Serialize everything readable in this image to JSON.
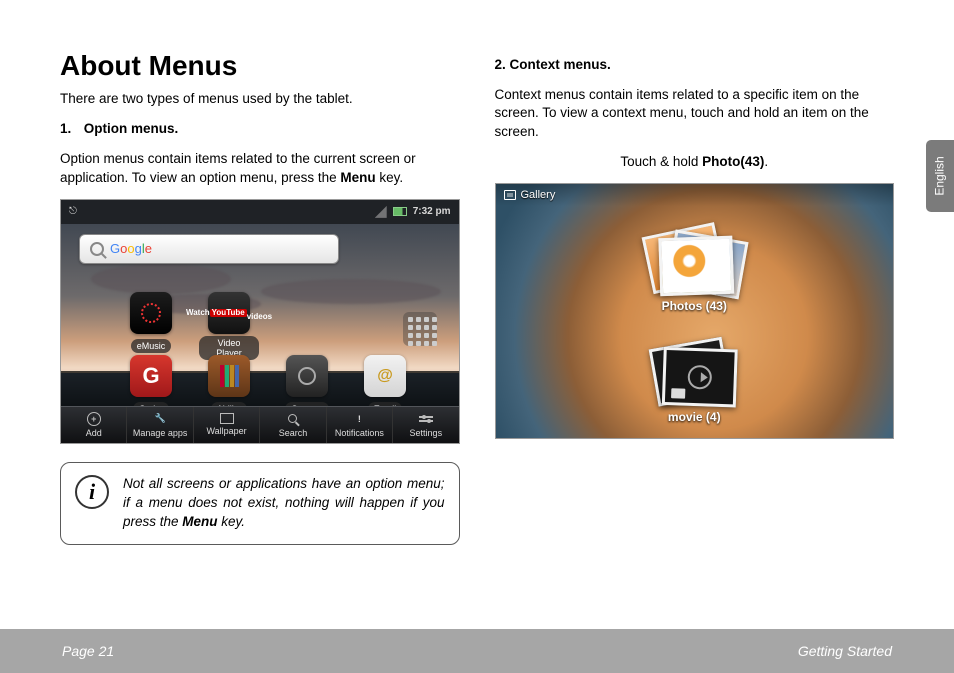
{
  "doc": {
    "title": "About Menus",
    "intro": "There are two types of menus used by the tablet.",
    "section1": {
      "num": "1.",
      "heading": "Option menus.",
      "body_pre": "Option menus contain items related to the current screen or application. To view an option menu, press the ",
      "body_bold": "Menu",
      "body_post": " key."
    },
    "section2": {
      "num": "2.",
      "heading": "Context menus.",
      "body": "Context menus contain items related to a specific item on the screen. To view a context menu, touch and hold an item on the screen.",
      "caption_pre": "Touch & hold ",
      "caption_bold": "Photo(43)",
      "caption_post": "."
    },
    "infobox": {
      "pre": "Not all screens or applications have an option menu; if a menu does not exist, nothing will happen if you press the ",
      "bold": "Menu",
      "post": " key."
    },
    "footer": {
      "left": "Page 21",
      "right": "Getting Started"
    },
    "sidetab": "English"
  },
  "home": {
    "time": "7:32 pm",
    "search_placeholder": "Google",
    "apps_row1": [
      {
        "label": "eMusic",
        "bg": "linear-gradient(#1d1d1d,#000)",
        "glyph": "◉"
      },
      {
        "label": "Video Player",
        "bg": "linear-gradient(#2b2b2b,#111)",
        "glyph": "You"
      }
    ],
    "apps_row2": [
      {
        "label": "Getjar",
        "bg": "linear-gradient(#d7372d,#a0181a)",
        "glyph": "G"
      },
      {
        "label": "Aldiko",
        "bg": "linear-gradient(#9c5a2a,#5e3517)",
        "glyph": "▥"
      },
      {
        "label": "Camera",
        "bg": "linear-gradient(#555,#222)",
        "glyph": "◎"
      },
      {
        "label": "Email",
        "bg": "linear-gradient(#e9d24f,#caa324)",
        "glyph": "@"
      }
    ],
    "menu": [
      {
        "label": "Add",
        "icon": "+"
      },
      {
        "label": "Manage apps",
        "icon": "🔧"
      },
      {
        "label": "Wallpaper",
        "icon": "🖼"
      },
      {
        "label": "Search",
        "icon": "🔍"
      },
      {
        "label": "Notifications",
        "icon": "!"
      },
      {
        "label": "Settings",
        "icon": "⚙"
      }
    ]
  },
  "gallery": {
    "header": "Gallery",
    "photos_label": "Photos  (43)",
    "movie_label": "movie  (4)"
  }
}
